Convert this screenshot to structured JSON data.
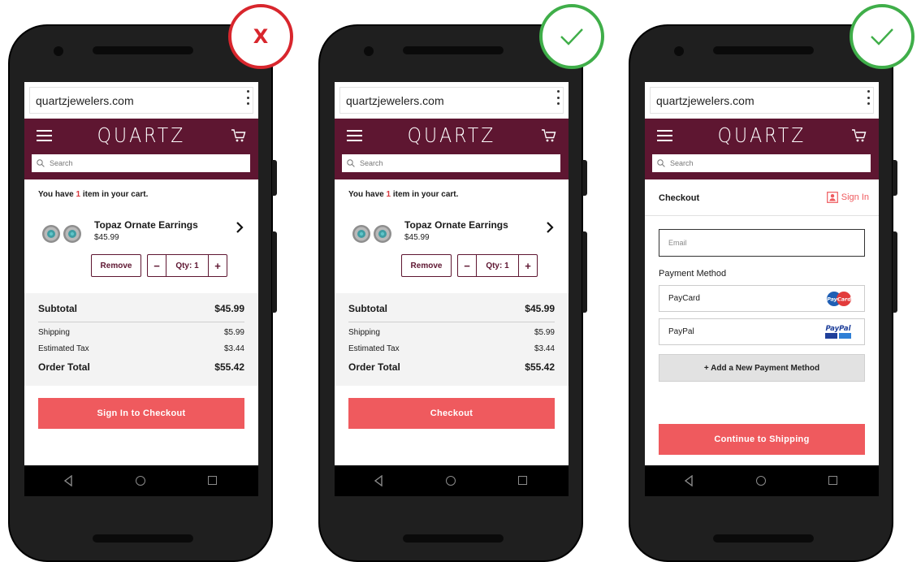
{
  "url": "quartzjewelers.com",
  "brand": "QUARTZ",
  "search_placeholder": "Search",
  "cart": {
    "message_pre": "You have ",
    "count": "1",
    "message_post": " item in your cart.",
    "product_name": "Topaz Ornate Earrings",
    "product_price": "$45.99",
    "remove_label": "Remove",
    "minus": "−",
    "qty_label": "Qty: 1",
    "plus": "+",
    "subtotal_label": "Subtotal",
    "subtotal_value": "$45.99",
    "shipping_label": "Shipping",
    "shipping_value": "$5.99",
    "tax_label": "Estimated Tax",
    "tax_value": "$3.44",
    "total_label": "Order Total",
    "total_value": "$55.42"
  },
  "badges": {
    "bad_mark": "X"
  },
  "screens": {
    "a_cta": "Sign In to Checkout",
    "b_cta": "Checkout"
  },
  "checkout": {
    "title": "Checkout",
    "signin": "Sign In",
    "email_placeholder": "Email",
    "payment_label": "Payment Method",
    "options": [
      "PayCard",
      "PayPal"
    ],
    "paycard_logo_text": "PayCard",
    "paypal_logo_text": "PayPal",
    "add_method": "+ Add a New Payment Method",
    "continue": "Continue to Shipping"
  },
  "colors": {
    "brand": "#5e1631",
    "cta": "#ef5a5e",
    "bad": "#d8262d",
    "good": "#3fae49"
  }
}
